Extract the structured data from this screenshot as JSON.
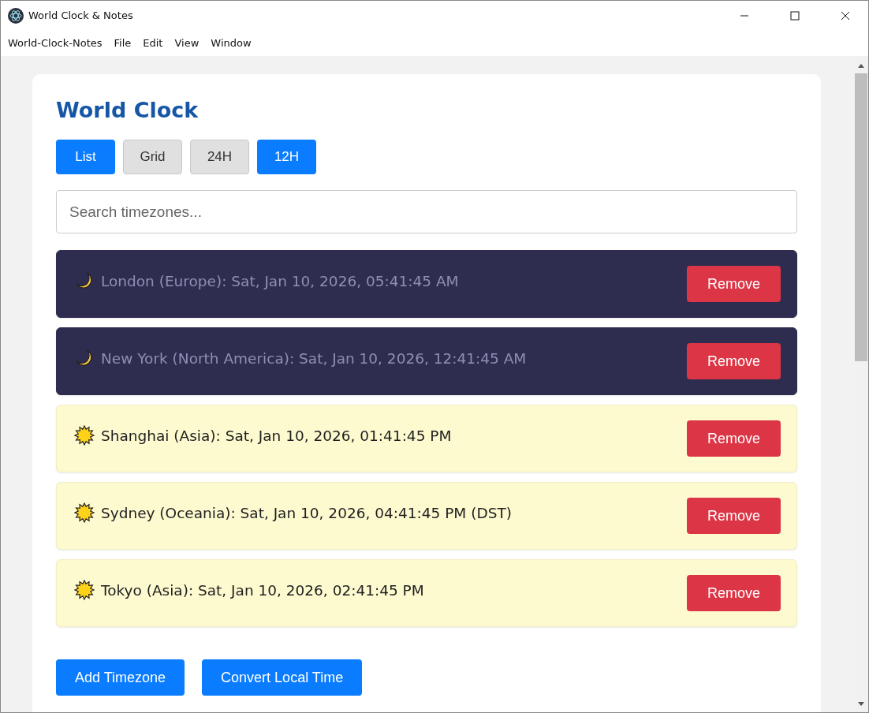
{
  "window": {
    "title": "World Clock & Notes"
  },
  "menu": [
    "World-Clock-Notes",
    "File",
    "Edit",
    "View",
    "Window"
  ],
  "heading": "World Clock",
  "toggles": [
    {
      "label": "List",
      "selected": true
    },
    {
      "label": "Grid",
      "selected": false
    },
    {
      "label": "24H",
      "selected": false
    },
    {
      "label": "12H",
      "selected": true
    }
  ],
  "search": {
    "placeholder": "Search timezones..."
  },
  "clocks": [
    {
      "kind": "night",
      "text": "London (Europe): Sat, Jan 10, 2026, 05:41:45 AM",
      "button": "Remove"
    },
    {
      "kind": "night",
      "text": "New York (North America): Sat, Jan 10, 2026, 12:41:45 AM",
      "button": "Remove"
    },
    {
      "kind": "day",
      "text": "Shanghai (Asia): Sat, Jan 10, 2026, 01:41:45 PM",
      "button": "Remove"
    },
    {
      "kind": "day",
      "text": "Sydney (Oceania): Sat, Jan 10, 2026, 04:41:45 PM (DST)",
      "button": "Remove"
    },
    {
      "kind": "day",
      "text": "Tokyo (Asia): Sat, Jan 10, 2026, 02:41:45 PM",
      "button": "Remove"
    }
  ],
  "actions": [
    "Add Timezone",
    "Convert Local Time"
  ]
}
